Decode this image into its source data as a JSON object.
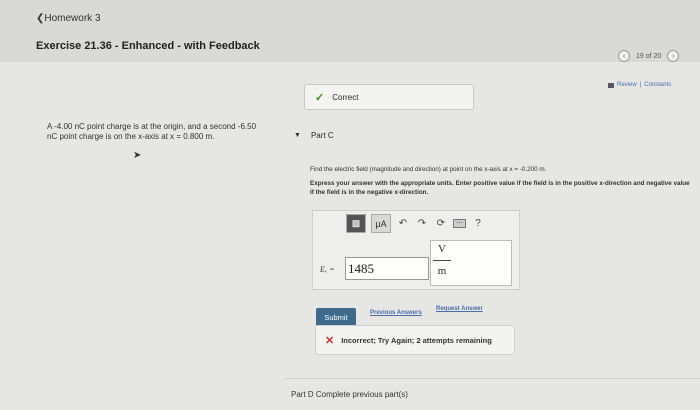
{
  "header": {
    "back_link": "❮Homework 3",
    "exercise_title": "Exercise 21.36 - Enhanced - with Feedback",
    "pager": "19 of 20",
    "review_link": "Review",
    "separator": "|",
    "constants_link": "Constants"
  },
  "problem_text": "A -4.00 nC point charge is at the origin, and a second -6.50 nC point charge is on the x-axis at x = 0.800 m.",
  "part_b": {
    "status": "Correct"
  },
  "part_c": {
    "label": "Part C",
    "question": "Find the electric field (magnitude and direction) at point on the x-axis at x = -0.200 m.",
    "instructions": "Express your answer with the appropriate units. Enter positive value if the field is in the positive x-direction and negative value if the field is in the negative x-direction.",
    "toolbar": {
      "mu_button": "μA",
      "help": "?"
    },
    "answer_label": "Eₓ =",
    "answer_value": "1485",
    "units_numerator": "V",
    "units_denominator": "m",
    "submit_label": "Submit",
    "previous_answers_link": "Previous Answers",
    "request_answer_link": "Request Answer",
    "feedback": "Incorrect; Try Again; 2 attempts remaining"
  },
  "part_d": {
    "label": "Part D",
    "text": "Complete previous part(s)"
  },
  "colors": {
    "accent": "#3e6b8d",
    "correct": "#3b8a1f",
    "incorrect": "#cc3333",
    "link": "#4a6ea8"
  }
}
